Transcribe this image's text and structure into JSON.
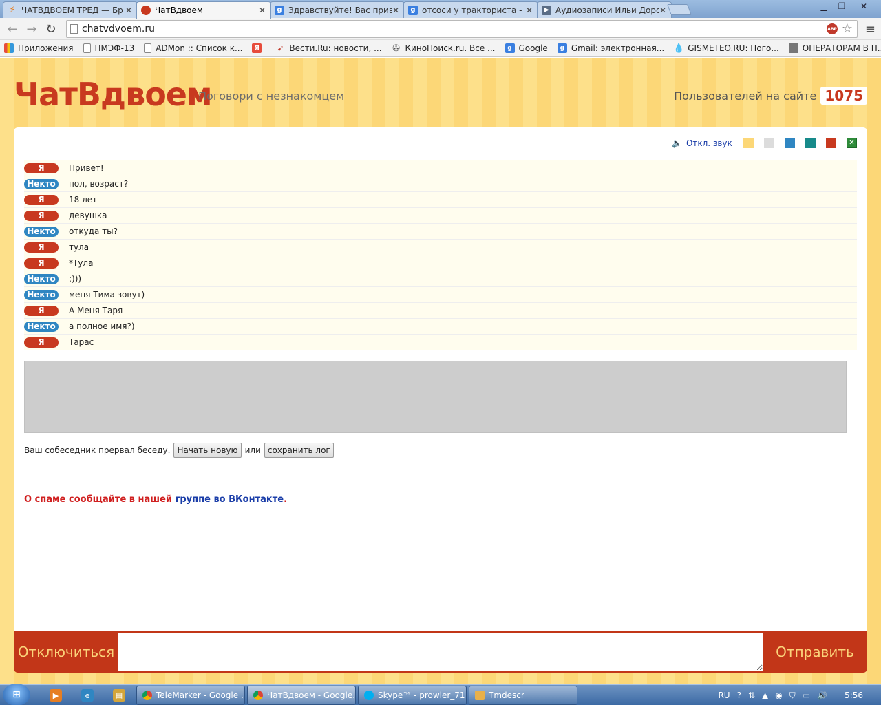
{
  "browser": {
    "tabs": [
      {
        "title": "ЧАТВДВОЕМ ТРЕД — Бр",
        "active": false,
        "icon": "lightning-icon"
      },
      {
        "title": "ЧатВдвоем",
        "active": true,
        "icon": "chat-bubble-icon"
      },
      {
        "title": "Здравствуйте! Вас привет",
        "active": false,
        "icon": "google-icon"
      },
      {
        "title": "отсоси у тракториста - П",
        "active": false,
        "icon": "google-icon"
      },
      {
        "title": "Аудиозаписи Ильи Доро",
        "active": false,
        "icon": "play-icon"
      }
    ],
    "url": "chatvdvoem.ru",
    "bookmarks": [
      {
        "label": "Приложения",
        "icon": "apps-grid-icon"
      },
      {
        "label": "ПМЭФ-13",
        "icon": "page-icon"
      },
      {
        "label": "ADMon :: Список к...",
        "icon": "page-icon"
      },
      {
        "label": "",
        "icon": "yandex-icon"
      },
      {
        "label": "Вести.Ru: новости, ...",
        "icon": "vesti-icon"
      },
      {
        "label": "КиноПоиск.ru. Все ...",
        "icon": "film-reel-icon"
      },
      {
        "label": "Google",
        "icon": "google-icon"
      },
      {
        "label": "Gmail: электронная...",
        "icon": "google-icon"
      },
      {
        "label": "GISMETEO.RU: Пого...",
        "icon": "drop-icon"
      },
      {
        "label": "ОПЕРАТОРАМ В П...",
        "icon": "folder-icon"
      }
    ]
  },
  "site": {
    "logo": "ЧатВдвоем",
    "tagline": "Поговори с незнакомцем",
    "online_label": "Пользователей на сайте",
    "online_count": "1075",
    "sound_toggle": "Откл. звук",
    "theme_colors": [
      "#fcd777",
      "#dcdcdc",
      "#2f86c2",
      "#178a8a",
      "#c8391f"
    ],
    "excel_icon": "excel-icon"
  },
  "chat": {
    "me_label": "Я",
    "them_label": "Некто",
    "messages": [
      {
        "from": "me",
        "text": "Привет!"
      },
      {
        "from": "them",
        "text": "пол, возраст?"
      },
      {
        "from": "me",
        "text": "18 лет"
      },
      {
        "from": "me",
        "text": "девушка"
      },
      {
        "from": "them",
        "text": "откуда ты?"
      },
      {
        "from": "me",
        "text": "тула"
      },
      {
        "from": "me",
        "text": "*Тула"
      },
      {
        "from": "them",
        "text": ":)))"
      },
      {
        "from": "them",
        "text": "меня Тима зовут)"
      },
      {
        "from": "me",
        "text": "А Меня Таря"
      },
      {
        "from": "them",
        "text": "а полное имя?)"
      },
      {
        "from": "me",
        "text": "Тарас"
      }
    ],
    "ended_text": "Ваш собеседник прервал беседу.",
    "new_chat_button": "Начать новую",
    "or_text": "или",
    "save_log_button": "сохранить лог",
    "spam_text": "О спаме сообщайте в нашей",
    "spam_link": "группе во ВКонтакте",
    "spam_end": "."
  },
  "controls": {
    "disconnect": "Отключиться",
    "send": "Отправить"
  },
  "taskbar": {
    "buttons": [
      {
        "label": "TeleMarker - Google ...",
        "icon": "chrome-icon"
      },
      {
        "label": "ЧатВдвоем - Google...",
        "icon": "chrome-icon"
      },
      {
        "label": "Skype™ - prowler_71",
        "icon": "skype-icon"
      },
      {
        "label": "Tmdescr",
        "icon": "pencil-icon"
      }
    ],
    "lang": "RU",
    "time": "5:56"
  }
}
